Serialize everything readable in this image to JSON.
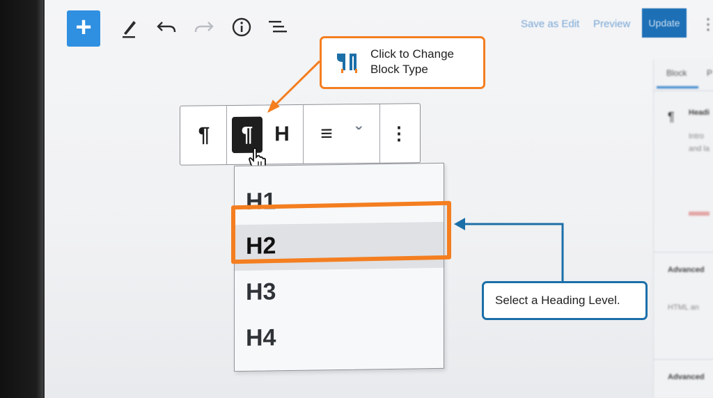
{
  "toolbar": {
    "add_label": "+",
    "icons": [
      "pencil-icon",
      "undo-icon",
      "redo-icon",
      "info-icon",
      "list-view-icon"
    ],
    "save_draft": "Save as Edit",
    "preview": "Preview",
    "update": "Update"
  },
  "sidebar": {
    "tab_block": "Block",
    "tab_other": "P",
    "block_name": "Headi",
    "desc_line1": "Intro",
    "desc_line2": "and la",
    "advanced": "Advanced",
    "anchor": "HTML an",
    "extra": "Advanced"
  },
  "block_toolbar": {
    "buttons": [
      "¶",
      "¶",
      "H",
      "≡",
      "ˇ",
      "⋮"
    ]
  },
  "dropdown": {
    "items": [
      "H1",
      "H2",
      "H3",
      "H4"
    ],
    "selected": "H2"
  },
  "callouts": {
    "change_block_type": "Click to Change Block Type",
    "select_heading": "Select a Heading Level."
  },
  "colors": {
    "accent_orange": "#f47e20",
    "accent_blue": "#1b6fa8",
    "wp_blue": "#2f8fe0",
    "dark": "#1e1e1e"
  }
}
